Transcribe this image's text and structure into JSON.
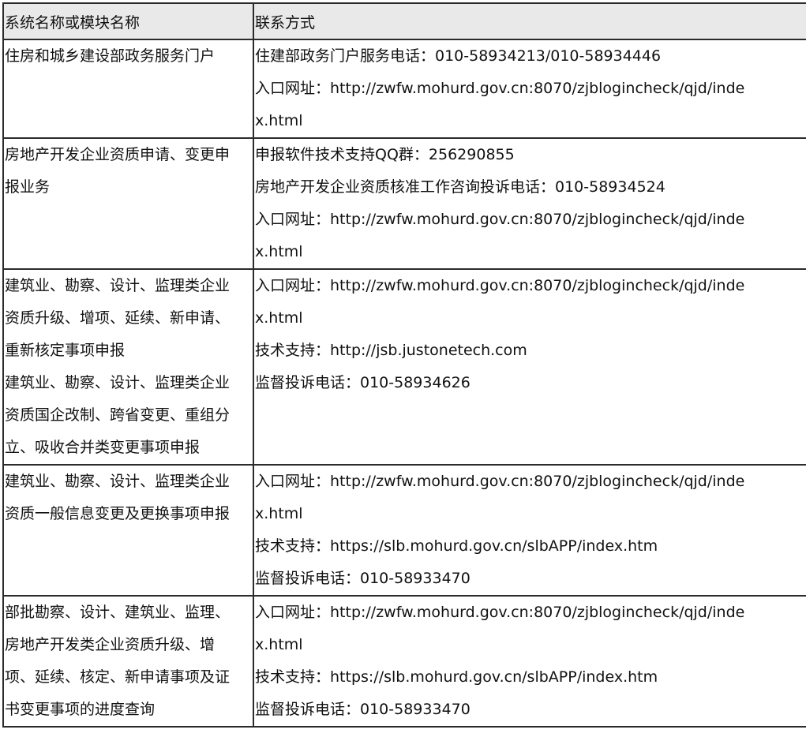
{
  "header": {
    "col_name": "系统名称或模块名称",
    "col_contact": "联系方式"
  },
  "rows": [
    {
      "name": [
        "住房和城乡建设部政务服务门户"
      ],
      "contact": [
        "住建部政务门户服务电话：010-58934213/010-58934446",
        "入口网址：http://zwfw.mohurd.gov.cn:8070/zjblogincheck/qjd/inde",
        "x.html"
      ]
    },
    {
      "name": [
        "房地产开发企业资质申请、变更申",
        "报业务"
      ],
      "contact": [
        "申报软件技术支持QQ群：256290855",
        "房地产开发企业资质核准工作咨询投诉电话：010-58934524",
        "入口网址：http://zwfw.mohurd.gov.cn:8070/zjblogincheck/qjd/inde",
        "x.html"
      ]
    },
    {
      "name": [
        "建筑业、勘察、设计、监理类企业",
        "资质升级、增项、延续、新申请、",
        "重新核定事项申报",
        "建筑业、勘察、设计、监理类企业",
        "资质国企改制、跨省变更、重组分",
        "立、吸收合并类变更事项申报"
      ],
      "contact": [
        "入口网址：http://zwfw.mohurd.gov.cn:8070/zjblogincheck/qjd/inde",
        "x.html",
        "技术支持：http://jsb.justonetech.com",
        "监督投诉电话：010-58934626"
      ]
    },
    {
      "name": [
        "建筑业、勘察、设计、监理类企业",
        "资质一般信息变更及更换事项申报"
      ],
      "contact": [
        "入口网址：http://zwfw.mohurd.gov.cn:8070/zjblogincheck/qjd/inde",
        "x.html",
        "技术支持：https://slb.mohurd.gov.cn/slbAPP/index.htm",
        "监督投诉电话：010-58933470"
      ]
    },
    {
      "name": [
        "部批勘察、设计、建筑业、监理、",
        "房地产开发类企业资质升级、增",
        "项、延续、核定、新申请事项及证",
        "书变更事项的进度查询"
      ],
      "contact": [
        "入口网址：http://zwfw.mohurd.gov.cn:8070/zjblogincheck/qjd/inde",
        "x.html",
        "技术支持：https://slb.mohurd.gov.cn/slbAPP/index.htm",
        "监督投诉电话：010-58933470"
      ]
    }
  ]
}
